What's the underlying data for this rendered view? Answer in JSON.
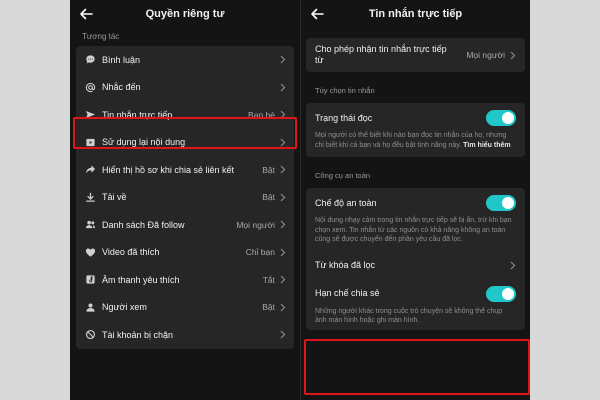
{
  "colors": {
    "panel_bg": "#141414",
    "card_bg": "#262626",
    "toggle_on": "#1fc7c9",
    "highlight": "#e0141b"
  },
  "left": {
    "title": "Quyền riêng tư",
    "section": "Tương tác",
    "items": [
      {
        "label": "Bình luận",
        "value": "",
        "icon": "comment-icon"
      },
      {
        "label": "Nhắc đến",
        "value": "",
        "icon": "at-sign-icon"
      },
      {
        "label": "Tin nhắn trực tiếp",
        "value": "Bạn bè",
        "icon": "send-icon"
      },
      {
        "label": "Sử dụng lại nội dung",
        "value": "",
        "icon": "video-reuse-icon"
      },
      {
        "label": "Hiển thị hồ sơ khi chia sẻ liên kết",
        "value": "Bật",
        "icon": "share-icon"
      },
      {
        "label": "Tải về",
        "value": "Bật",
        "icon": "download-icon"
      },
      {
        "label": "Danh sách Đã follow",
        "value": "Mọi người",
        "icon": "people-icon"
      },
      {
        "label": "Video đã thích",
        "value": "Chỉ bạn",
        "icon": "heart-icon"
      },
      {
        "label": "Âm thanh yêu thích",
        "value": "Tắt",
        "icon": "music-icon"
      },
      {
        "label": "Người xem",
        "value": "Bật",
        "icon": "viewers-icon"
      },
      {
        "label": "Tài khoản bị chặn",
        "value": "",
        "icon": "blocked-icon"
      }
    ]
  },
  "right": {
    "title": "Tin nhắn trực tiếp",
    "allow": {
      "label": "Cho phép nhận tin nhắn trực tiếp từ",
      "value": "Mọi người"
    },
    "section_options": "Tùy chọn tin nhắn",
    "read_status": {
      "title": "Trạng thái đọc",
      "desc": "Mọi người có thể biết khi nào bạn đọc tin nhắn của họ, nhưng chỉ biết khi cả bạn và họ đều bật tính năng này.",
      "link": "Tìm hiểu thêm",
      "on": true
    },
    "section_safety": "Công cụ an toàn",
    "safe_mode": {
      "title": "Chế độ an toàn",
      "desc": "Nội dung nhạy cảm trong tin nhắn trực tiếp sẽ bị ẩn, trừ khi bạn chọn xem. Tin nhắn từ các nguồn có khả năng không an toàn cũng sẽ được chuyển đến phần yêu cầu đã lọc.",
      "on": true
    },
    "keyword_filter": {
      "title": "Từ khóa đã lọc"
    },
    "restrict_sharing": {
      "title": "Hạn chế chia sẻ",
      "desc": "Những người khác trong cuộc trò chuyện sẽ không thể chụp ảnh màn hình hoặc ghi màn hình.",
      "on": true
    }
  }
}
